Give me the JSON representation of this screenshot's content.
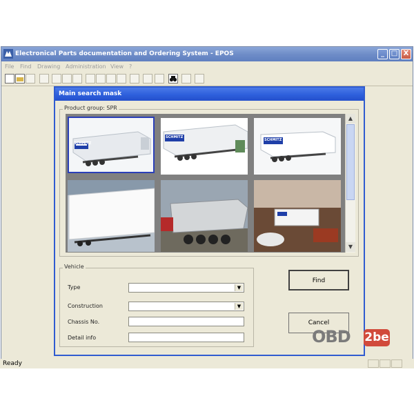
{
  "window": {
    "title": "Electronical Parts documentation and Ordering System - EPOS",
    "controls": {
      "minimize": "_",
      "maximize": "□",
      "close": "X"
    }
  },
  "menu": [
    "File",
    "Find",
    "Drawing",
    "Administration",
    "View",
    "?"
  ],
  "toolbar_icons": [
    "new-icon",
    "open-icon",
    "save-icon",
    "print-icon",
    "zoom-in-icon",
    "zoom-out-icon",
    "fit-icon",
    "first-icon",
    "prev-icon",
    "next-icon",
    "last-icon",
    "parts-list-icon",
    "table-icon",
    "doc-icon",
    "find-binoculars-icon",
    "refresh-icon",
    "tool-icon"
  ],
  "dialog": {
    "title": "Main search mask",
    "product_group_label": "Product group: SPR",
    "vehicle_group_label": "Vehicle",
    "fields": {
      "type_label": "Type",
      "construction_label": "Construction",
      "chassis_label": "Chassis No.",
      "detail_label": "Detail info",
      "type_value": "",
      "construction_value": "",
      "chassis_value": "",
      "detail_value": ""
    },
    "buttons": {
      "find": "Find",
      "cancel": "Cancel"
    }
  },
  "status": {
    "text": "Ready"
  },
  "watermark": {
    "text": "OBD",
    "badge": "2be"
  },
  "thumbs": [
    {
      "brand": "SCHMITZ",
      "kind": "curtain"
    },
    {
      "brand": "SCHMITZ",
      "kind": "curtain"
    },
    {
      "brand": "SCHMITZ",
      "kind": "reefer"
    },
    {
      "brand": "",
      "kind": "box"
    },
    {
      "brand": "",
      "kind": "tipper"
    },
    {
      "brand": "",
      "kind": "interior"
    }
  ],
  "colors": {
    "title_active": "#2d5fdc",
    "title_inactive": "#6f8dc8",
    "brand_blue": "#1f3fa8"
  }
}
